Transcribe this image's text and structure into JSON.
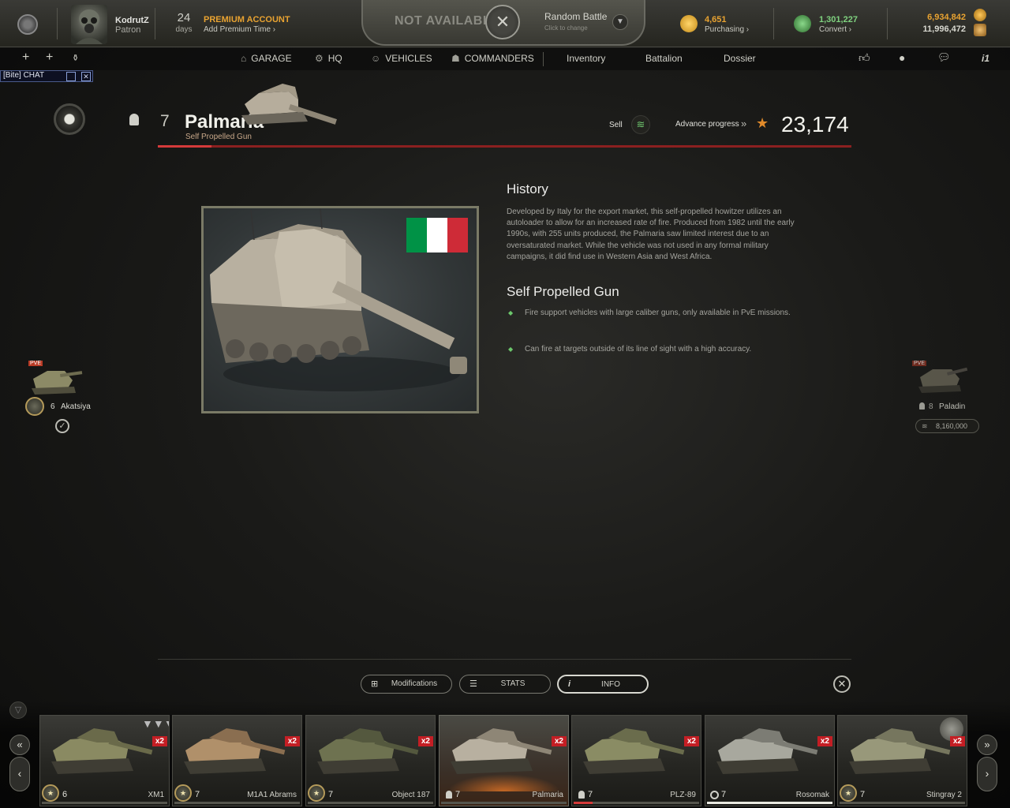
{
  "header": {
    "username": "KodrutZ",
    "rank": "Patron",
    "premium_days": "24",
    "premium_days_label": "days",
    "premium_title": "PREMIUM ACCOUNT",
    "premium_link": "Add Premium Time ›"
  },
  "battle": {
    "status": "NOT AVAILABLE",
    "mode": "Random Battle",
    "hint": "Click to change"
  },
  "currency": {
    "gold_value": "4,651",
    "gold_link": "Purchasing ›",
    "credits_value": "1,301,227",
    "credits_link": "Convert ›",
    "exp_value_1": "6,934,842",
    "exp_value_2": "11,996,472"
  },
  "colors": {
    "gold": "#e9a331",
    "credits_green": "#6fc86f",
    "premium_orange": "#e9a331",
    "accent_red": "#c41e24",
    "bullet_green": "#6cc86c"
  },
  "nav": {
    "items": [
      {
        "label": "GARAGE",
        "icon": "garage-icon"
      },
      {
        "label": "HQ",
        "icon": "hq-icon"
      },
      {
        "label": "VEHICLES",
        "icon": "vehicles-icon"
      },
      {
        "label": "COMMANDERS",
        "icon": "commanders-icon"
      },
      {
        "label": "Inventory"
      },
      {
        "label": "Battalion"
      },
      {
        "label": "Dossier"
      }
    ],
    "right_icon_label": "i1"
  },
  "chat": {
    "label": "[Bite] CHAT"
  },
  "vehicle": {
    "tier": "7",
    "name": "Palmaria",
    "class": "Self Propelled Gun",
    "sell_label": "Sell",
    "advance_label": "Advance progress",
    "advance_value": "23,174",
    "flag_colors": [
      "#009246",
      "#ffffff",
      "#ce2b37"
    ]
  },
  "info": {
    "history_title": "History",
    "history_text": "Developed by Italy  for the export market, this self-propelled howitzer utilizes an autoloader to allow for an increased rate of fire. Produced from 1982 until the early 1990s, with 255 units produced, the Palmaria saw limited interest due to an oversaturated market. While the vehicle was not used in any formal military campaigns, it did find use in Western Asia and West Africa.",
    "class_title": "Self Propelled Gun",
    "bullets": [
      "Fire support vehicles with large caliber guns, only available in PvE missions.",
      "Can fire at targets outside of its line of sight with a high accuracy."
    ]
  },
  "prev_vehicle": {
    "badge": "PVE",
    "tier": "6",
    "name": "Akatsiya"
  },
  "next_vehicle": {
    "badge": "PVE",
    "tier": "8",
    "name": "Paladin",
    "price": "8,160,000"
  },
  "tabs": {
    "modifications": "Modifications",
    "stats": "STATS",
    "info": "INFO"
  },
  "carousel": [
    {
      "tier": "6",
      "name": "XM1",
      "bonus": "x2",
      "progress": 0.0
    },
    {
      "tier": "7",
      "name": "M1A1 Abrams",
      "bonus": "x2",
      "progress": 0.0
    },
    {
      "tier": "7",
      "name": "Object 187",
      "bonus": "x2",
      "progress": 0.0
    },
    {
      "tier": "7",
      "name": "Palmaria",
      "bonus": "x2",
      "progress": 0.0
    },
    {
      "tier": "7",
      "name": "PLZ-89",
      "bonus": "x2",
      "progress": 0.15
    },
    {
      "tier": "7",
      "name": "Rosomak",
      "bonus": "x2",
      "progress": 1.0
    },
    {
      "tier": "7",
      "name": "Stingray 2",
      "bonus": "x2",
      "progress": 0.0
    }
  ]
}
